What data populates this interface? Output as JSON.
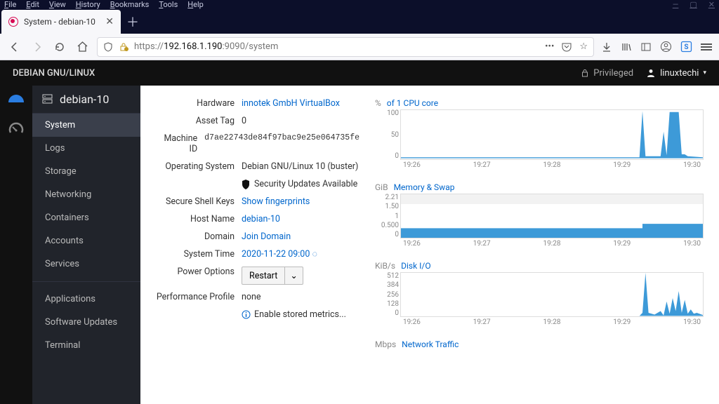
{
  "browser": {
    "menus": [
      "File",
      "Edit",
      "View",
      "History",
      "Bookmarks",
      "Tools",
      "Help"
    ],
    "tab_title": "System - debian-10",
    "url_plain_prefix": "https://",
    "url_highlight": "192.168.1.190",
    "url_plain_suffix": ":9090/system"
  },
  "cockpit": {
    "brand": "DEBIAN GNU/LINUX",
    "privileged": "Privileged",
    "user": "linuxtechi",
    "host": "debian-10",
    "nav": [
      "System",
      "Logs",
      "Storage",
      "Networking",
      "Containers",
      "Accounts",
      "Services"
    ],
    "nav2": [
      "Applications",
      "Software Updates",
      "Terminal"
    ]
  },
  "info": {
    "hardware_lbl": "Hardware",
    "hardware": "innotek GmbH VirtualBox",
    "asset_lbl": "Asset Tag",
    "asset": "0",
    "mid_lbl": "Machine ID",
    "mid": "d7ae22743de84f97bac9e25e064735fe",
    "os_lbl": "Operating System",
    "os": "Debian GNU/Linux 10 (buster)",
    "sec_upd": "Security Updates Available",
    "ssh_lbl": "Secure Shell Keys",
    "ssh": "Show fingerprints",
    "hostname_lbl": "Host Name",
    "hostname": "debian-10",
    "domain_lbl": "Domain",
    "domain": "Join Domain",
    "time_lbl": "System Time",
    "time": "2020-11-22 09:00",
    "power_lbl": "Power Options",
    "power_btn": "Restart",
    "perf_lbl": "Performance Profile",
    "perf": "none",
    "enable_metrics": "Enable stored metrics..."
  },
  "charts": {
    "cpu": {
      "unit": "%",
      "name": "of 1 CPU core",
      "ymax": 100,
      "yticks": [
        "100",
        "50",
        "0"
      ],
      "xticks": [
        "19:26",
        "19:27",
        "19:28",
        "19:29",
        "19:30"
      ]
    },
    "mem": {
      "unit": "GiB",
      "name": "Memory & Swap",
      "yticks": [
        "2.21",
        "1.50",
        "1",
        "0.500",
        "0"
      ],
      "xticks": [
        "19:26",
        "19:27",
        "19:28",
        "19:29",
        "19:30"
      ]
    },
    "disk": {
      "unit": "KiB/s",
      "name": "Disk I/O",
      "yticks": [
        "512",
        "384",
        "256",
        "128",
        "0"
      ],
      "xticks": [
        "19:26",
        "19:27",
        "19:28",
        "19:29",
        "19:30"
      ]
    },
    "net": {
      "unit": "Mbps",
      "name": "Network Traffic"
    }
  },
  "chart_data": [
    {
      "type": "area",
      "title": "% of 1 CPU core",
      "series": [
        {
          "name": "cpu",
          "values": [
            3,
            2,
            3,
            2,
            3,
            2,
            3,
            2,
            3,
            2,
            3,
            2,
            3,
            2,
            3,
            2,
            3,
            2,
            3,
            2,
            3,
            2,
            3,
            2,
            3,
            2,
            3,
            2,
            3,
            2,
            3,
            2,
            3,
            2,
            3,
            2,
            3,
            2,
            3,
            2,
            3,
            2,
            3,
            2,
            3,
            2,
            3,
            2,
            3,
            2,
            3,
            2,
            3,
            2,
            3,
            2,
            3,
            2,
            3,
            2,
            3,
            2,
            3,
            2,
            3,
            2,
            3,
            2,
            3,
            2,
            3,
            2,
            3,
            2,
            3,
            2,
            3,
            2,
            3,
            4,
            98,
            6,
            5,
            4,
            5,
            5,
            55,
            8,
            6,
            95,
            97,
            96,
            10,
            6,
            10,
            5,
            6,
            5,
            4,
            4
          ]
        }
      ],
      "x": [
        "19:26",
        "19:27",
        "19:28",
        "19:29",
        "19:30"
      ],
      "ylim": [
        0,
        100
      ],
      "xlabel": "",
      "ylabel": "%"
    },
    {
      "type": "area",
      "title": "Memory & Swap (GiB)",
      "series": [
        {
          "name": "memory",
          "values": [
            0.48,
            0.48,
            0.48,
            0.48,
            0.48,
            0.48,
            0.48,
            0.48,
            0.48,
            0.48,
            0.48,
            0.48,
            0.48,
            0.48,
            0.48,
            0.48,
            0.48,
            0.48,
            0.48,
            0.48,
            0.48,
            0.48,
            0.48,
            0.48,
            0.48,
            0.48,
            0.48,
            0.48,
            0.48,
            0.48,
            0.48,
            0.48,
            0.48,
            0.48,
            0.48,
            0.48,
            0.48,
            0.48,
            0.48,
            0.48,
            0.48,
            0.48,
            0.48,
            0.48,
            0.48,
            0.48,
            0.48,
            0.48,
            0.48,
            0.48,
            0.48,
            0.48,
            0.48,
            0.48,
            0.48,
            0.48,
            0.48,
            0.48,
            0.48,
            0.48,
            0.48,
            0.48,
            0.48,
            0.48,
            0.48,
            0.48,
            0.48,
            0.48,
            0.48,
            0.48,
            0.48,
            0.48,
            0.48,
            0.48,
            0.48,
            0.48,
            0.48,
            0.48,
            0.48,
            0.48,
            0.7,
            0.7,
            0.7,
            0.7,
            0.7,
            0.7,
            0.7,
            0.7,
            0.7,
            0.7,
            0.7,
            0.7,
            0.7,
            0.7,
            0.7,
            0.7,
            0.7,
            0.7,
            0.7,
            0.7
          ]
        },
        {
          "name": "swap",
          "values": [
            0,
            0,
            0,
            0,
            0,
            0,
            0,
            0,
            0,
            0,
            0,
            0,
            0,
            0,
            0,
            0,
            0,
            0,
            0,
            0,
            0,
            0,
            0,
            0,
            0,
            0,
            0,
            0,
            0,
            0,
            0,
            0,
            0,
            0,
            0,
            0,
            0,
            0,
            0,
            0,
            0,
            0,
            0,
            0,
            0,
            0,
            0,
            0,
            0,
            0,
            0,
            0,
            0,
            0,
            0,
            0,
            0,
            0,
            0,
            0,
            0,
            0,
            0,
            0,
            0,
            0,
            0,
            0,
            0,
            0,
            0,
            0,
            0,
            0,
            0,
            0,
            0,
            0,
            0,
            0,
            0,
            0,
            0,
            0,
            0,
            0,
            0,
            0,
            0,
            0,
            0,
            0,
            0,
            0,
            0,
            0,
            0,
            0,
            0,
            0
          ]
        }
      ],
      "x": [
        "19:26",
        "19:27",
        "19:28",
        "19:29",
        "19:30"
      ],
      "ylim": [
        0,
        2.21
      ],
      "xlabel": "",
      "ylabel": "GiB"
    },
    {
      "type": "area",
      "title": "Disk I/O (KiB/s)",
      "series": [
        {
          "name": "io",
          "values": [
            5,
            4,
            5,
            4,
            5,
            4,
            5,
            4,
            5,
            4,
            5,
            4,
            5,
            4,
            5,
            4,
            5,
            4,
            5,
            4,
            5,
            4,
            5,
            4,
            5,
            4,
            5,
            4,
            5,
            4,
            5,
            4,
            5,
            4,
            5,
            4,
            5,
            4,
            5,
            4,
            5,
            4,
            5,
            4,
            5,
            4,
            5,
            4,
            5,
            4,
            5,
            4,
            5,
            4,
            5,
            4,
            5,
            4,
            5,
            4,
            5,
            4,
            5,
            4,
            5,
            4,
            5,
            4,
            5,
            4,
            5,
            4,
            5,
            4,
            5,
            4,
            5,
            4,
            5,
            6,
            40,
            520,
            40,
            5,
            20,
            5,
            60,
            10,
            180,
            30,
            220,
            60,
            300,
            40,
            200,
            30,
            80,
            30,
            40,
            15
          ]
        }
      ],
      "x": [
        "19:26",
        "19:27",
        "19:28",
        "19:29",
        "19:30"
      ],
      "ylim": [
        0,
        512
      ],
      "xlabel": "",
      "ylabel": "KiB/s"
    }
  ]
}
